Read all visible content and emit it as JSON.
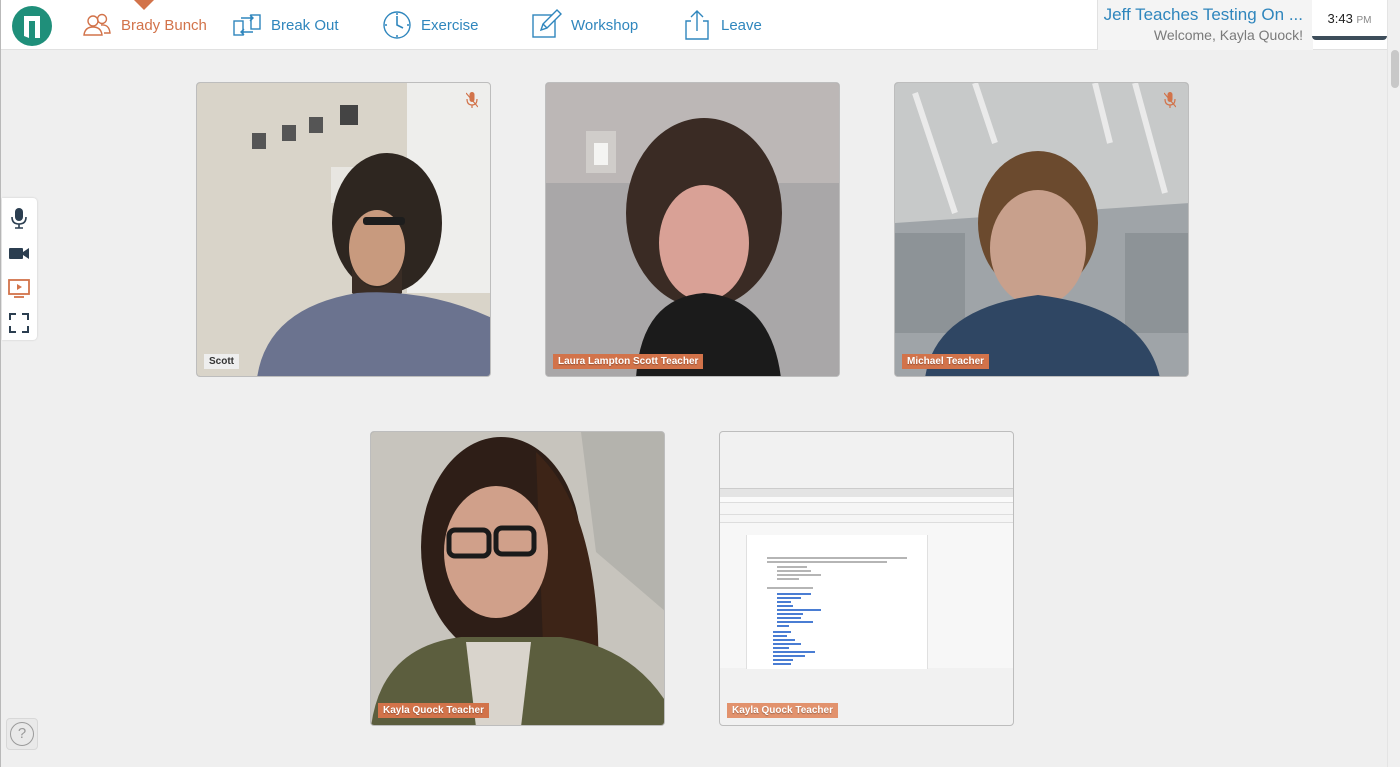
{
  "nav": {
    "items": [
      {
        "label": "Brady Bunch",
        "active": true
      },
      {
        "label": "Break Out",
        "active": false
      },
      {
        "label": "Exercise",
        "active": false
      },
      {
        "label": "Workshop",
        "active": false
      },
      {
        "label": "Leave",
        "active": false
      }
    ]
  },
  "header": {
    "course_title": "Jeff Teaches Testing On ...",
    "welcome": "Welcome, Kayla Quock!"
  },
  "clock": {
    "time": "3:43",
    "ampm": "PM"
  },
  "sidebar": {
    "tools": [
      {
        "icon": "microphone-icon"
      },
      {
        "icon": "video-camera-icon"
      },
      {
        "icon": "screen-share-icon",
        "active": true
      },
      {
        "icon": "fullscreen-icon"
      }
    ]
  },
  "help": {
    "label": "?"
  },
  "tiles": [
    {
      "label": "Scott",
      "muted": true
    },
    {
      "label": "Laura Lampton Scott Teacher",
      "muted": false
    },
    {
      "label": "Michael Teacher",
      "muted": true
    },
    {
      "label": "Kayla Quock Teacher",
      "muted": false
    },
    {
      "label": "Kayla Quock Teacher",
      "muted": false,
      "screen_share": true
    }
  ],
  "colors": {
    "accent": "#d2734a",
    "link": "#2f86bd",
    "brand": "#1f8f7a"
  }
}
